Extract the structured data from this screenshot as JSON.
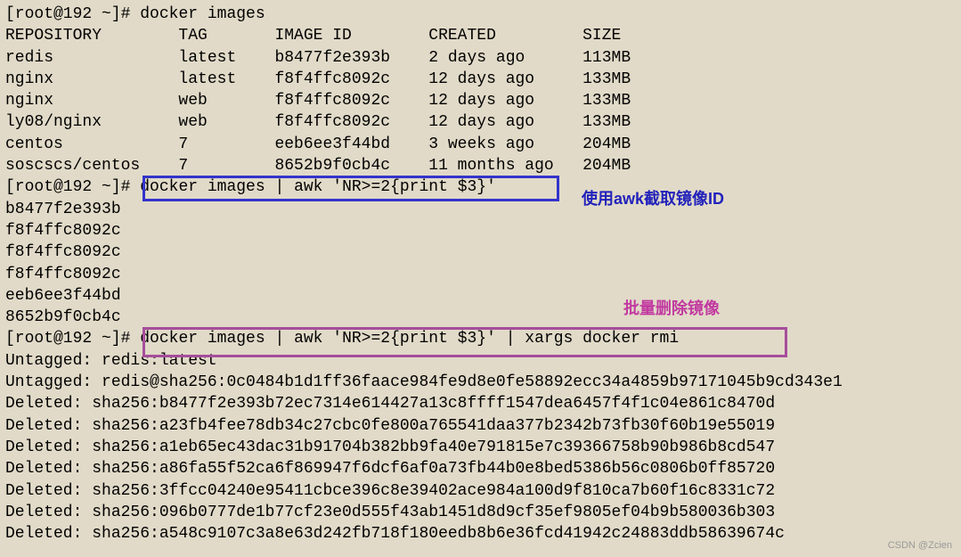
{
  "prompt": "[root@192 ~]# ",
  "commands": {
    "cmd1": "docker images",
    "cmd2": "docker images | awk 'NR>=2{print $3}'",
    "cmd3": "docker images | awk 'NR>=2{print $3}' | xargs docker rmi"
  },
  "table_header": "REPOSITORY        TAG       IMAGE ID        CREATED         SIZE",
  "table_rows": [
    "redis             latest    b8477f2e393b    2 days ago      113MB",
    "nginx             latest    f8f4ffc8092c    12 days ago     133MB",
    "nginx             web       f8f4ffc8092c    12 days ago     133MB",
    "ly08/nginx        web       f8f4ffc8092c    12 days ago     133MB",
    "centos            7         eeb6ee3f44bd    3 weeks ago     204MB",
    "soscscs/centos    7         8652b9f0cb4c    11 months ago   204MB"
  ],
  "awk_output": [
    "b8477f2e393b",
    "f8f4ffc8092c",
    "f8f4ffc8092c",
    "f8f4ffc8092c",
    "eeb6ee3f44bd",
    "8652b9f0cb4c"
  ],
  "rmi_output": [
    "Untagged: redis:latest",
    "Untagged: redis@sha256:0c0484b1d1ff36faace984fe9d8e0fe58892ecc34a4859b97171045b9cd343e1",
    "Deleted: sha256:b8477f2e393b72ec7314e614427a13c8ffff1547dea6457f4f1c04e861c8470d",
    "Deleted: sha256:a23fb4fee78db34c27cbc0fe800a765541daa377b2342b73fb30f60b19e55019",
    "Deleted: sha256:a1eb65ec43dac31b91704b382bb9fa40e791815e7c39366758b90b986b8cd547",
    "Deleted: sha256:a86fa55f52ca6f869947f6dcf6af0a73fb44b0e8bed5386b56c0806b0ff85720",
    "Deleted: sha256:3ffcc04240e95411cbce396c8e39402ace984a100d9f810ca7b60f16c8331c72",
    "Deleted: sha256:096b0777de1b77cf23e0d555f43ab1451d8d9cf35ef9805ef04b9b580036b303",
    "Deleted: sha256:a548c9107c3a8e63d242fb718f180eedb8b6e36fcd41942c24883ddb58639674c"
  ],
  "annotations": {
    "blue_label": "使用awk截取镜像ID",
    "purple_label": "批量删除镜像"
  },
  "watermark": "CSDN @Zcien"
}
